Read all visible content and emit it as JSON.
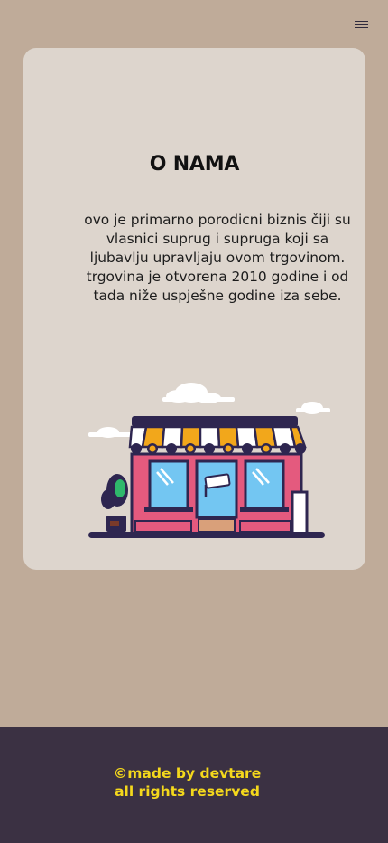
{
  "header": {
    "menu_icon": "hamburger-menu-icon"
  },
  "about": {
    "title": "O NAMA",
    "description": "ovo je primarno porodicni biznis čiji su vlasnici suprug i supruga koji sa ljubavlju upravljaju ovom trgovinom. trgovina je otvorena 2010 godine i od tada niže uspješne godine iza sebe.",
    "illustration": "shop-storefront-illustration"
  },
  "footer": {
    "line1": "©made by devtare",
    "line2": "all rights reserved"
  },
  "colors": {
    "page_background": "#bfab99",
    "card_background": "#ddd5cd",
    "footer_background": "#3b3143",
    "footer_text": "#f4d81c",
    "shop_outline": "#2e2650",
    "shop_awning_accent": "#f2a71b",
    "shop_window": "#73c6f2",
    "shop_pink": "#e45a7e"
  }
}
